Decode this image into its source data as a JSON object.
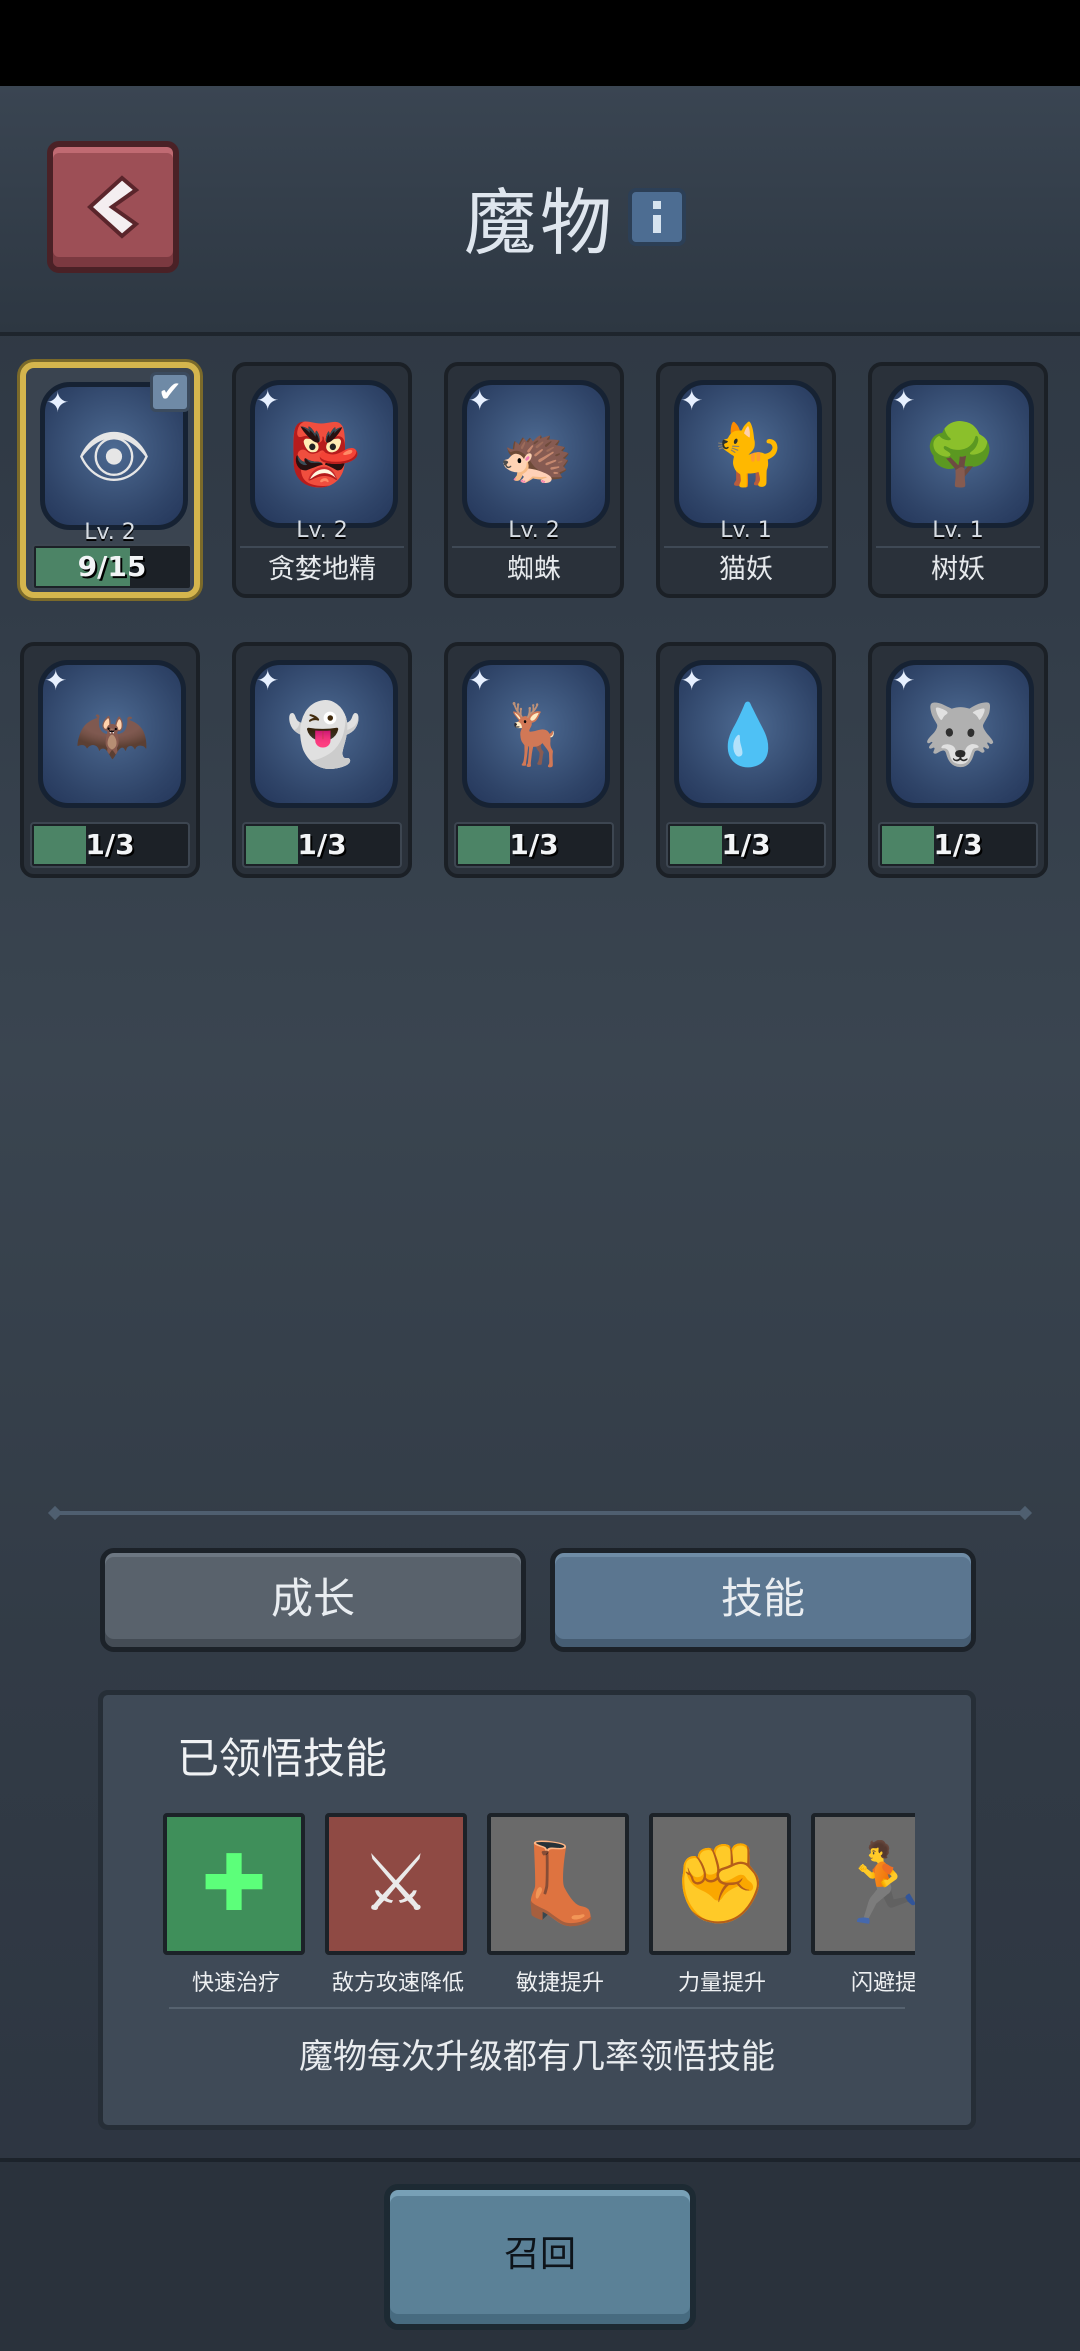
{
  "header": {
    "title": "魔物"
  },
  "monsters": [
    {
      "name": "",
      "level": "Lv. 2",
      "progress_text": "9/15",
      "progress": 0.6,
      "selected": true,
      "emoji": "👁"
    },
    {
      "name": "贪婪地精",
      "level": "Lv. 2",
      "emoji": "👺"
    },
    {
      "name": "蜘蛛",
      "level": "Lv. 2",
      "emoji": "🦔"
    },
    {
      "name": "猫妖",
      "level": "Lv. 1",
      "emoji": "🐈"
    },
    {
      "name": "树妖",
      "level": "Lv. 1",
      "emoji": "🌳"
    },
    {
      "progress_text": "1/3",
      "progress": 0.3333,
      "emoji": "🦇"
    },
    {
      "progress_text": "1/3",
      "progress": 0.3333,
      "emoji": "👻"
    },
    {
      "progress_text": "1/3",
      "progress": 0.3333,
      "emoji": "🦌"
    },
    {
      "progress_text": "1/3",
      "progress": 0.3333,
      "emoji": "💧"
    },
    {
      "progress_text": "1/3",
      "progress": 0.3333,
      "emoji": "🐺"
    }
  ],
  "tabs": {
    "growth": "成长",
    "skills": "技能"
  },
  "skills_panel": {
    "title": "已领悟技能",
    "skills": [
      {
        "label": "快速治疗",
        "icon": "green-cross-icon",
        "color": "#3f8f5a"
      },
      {
        "label": "敌方攻速降低",
        "icon": "swords-down-icon",
        "color": "#8f4a44"
      },
      {
        "label": "敏捷提升",
        "icon": "boot-up-icon",
        "color": "#6a6a6a"
      },
      {
        "label": "力量提升",
        "icon": "fist-up-icon",
        "color": "#6a6a6a"
      },
      {
        "label": "闪避提",
        "icon": "dodge-up-icon",
        "color": "#6a6a6a"
      }
    ],
    "tip": "魔物每次升级都有几率领悟技能"
  },
  "bottom": {
    "summon_label": "召回"
  }
}
